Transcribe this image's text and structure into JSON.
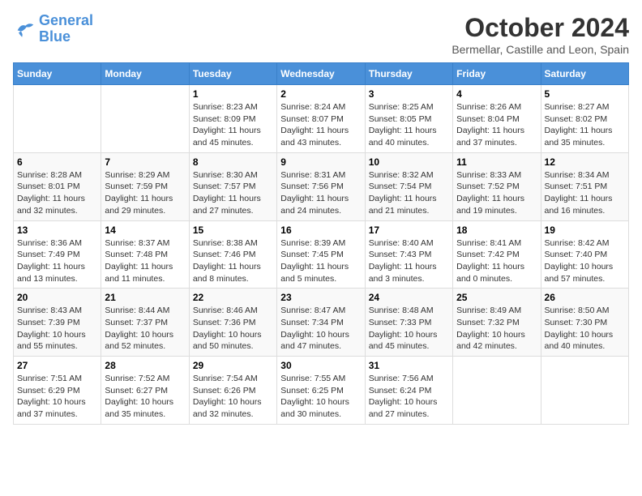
{
  "logo": {
    "text1": "General",
    "text2": "Blue"
  },
  "title": "October 2024",
  "location": "Bermellar, Castille and Leon, Spain",
  "days_header": [
    "Sunday",
    "Monday",
    "Tuesday",
    "Wednesday",
    "Thursday",
    "Friday",
    "Saturday"
  ],
  "weeks": [
    [
      {
        "day": "",
        "info": ""
      },
      {
        "day": "",
        "info": ""
      },
      {
        "day": "1",
        "info": "Sunrise: 8:23 AM\nSunset: 8:09 PM\nDaylight: 11 hours and 45 minutes."
      },
      {
        "day": "2",
        "info": "Sunrise: 8:24 AM\nSunset: 8:07 PM\nDaylight: 11 hours and 43 minutes."
      },
      {
        "day": "3",
        "info": "Sunrise: 8:25 AM\nSunset: 8:05 PM\nDaylight: 11 hours and 40 minutes."
      },
      {
        "day": "4",
        "info": "Sunrise: 8:26 AM\nSunset: 8:04 PM\nDaylight: 11 hours and 37 minutes."
      },
      {
        "day": "5",
        "info": "Sunrise: 8:27 AM\nSunset: 8:02 PM\nDaylight: 11 hours and 35 minutes."
      }
    ],
    [
      {
        "day": "6",
        "info": "Sunrise: 8:28 AM\nSunset: 8:01 PM\nDaylight: 11 hours and 32 minutes."
      },
      {
        "day": "7",
        "info": "Sunrise: 8:29 AM\nSunset: 7:59 PM\nDaylight: 11 hours and 29 minutes."
      },
      {
        "day": "8",
        "info": "Sunrise: 8:30 AM\nSunset: 7:57 PM\nDaylight: 11 hours and 27 minutes."
      },
      {
        "day": "9",
        "info": "Sunrise: 8:31 AM\nSunset: 7:56 PM\nDaylight: 11 hours and 24 minutes."
      },
      {
        "day": "10",
        "info": "Sunrise: 8:32 AM\nSunset: 7:54 PM\nDaylight: 11 hours and 21 minutes."
      },
      {
        "day": "11",
        "info": "Sunrise: 8:33 AM\nSunset: 7:52 PM\nDaylight: 11 hours and 19 minutes."
      },
      {
        "day": "12",
        "info": "Sunrise: 8:34 AM\nSunset: 7:51 PM\nDaylight: 11 hours and 16 minutes."
      }
    ],
    [
      {
        "day": "13",
        "info": "Sunrise: 8:36 AM\nSunset: 7:49 PM\nDaylight: 11 hours and 13 minutes."
      },
      {
        "day": "14",
        "info": "Sunrise: 8:37 AM\nSunset: 7:48 PM\nDaylight: 11 hours and 11 minutes."
      },
      {
        "day": "15",
        "info": "Sunrise: 8:38 AM\nSunset: 7:46 PM\nDaylight: 11 hours and 8 minutes."
      },
      {
        "day": "16",
        "info": "Sunrise: 8:39 AM\nSunset: 7:45 PM\nDaylight: 11 hours and 5 minutes."
      },
      {
        "day": "17",
        "info": "Sunrise: 8:40 AM\nSunset: 7:43 PM\nDaylight: 11 hours and 3 minutes."
      },
      {
        "day": "18",
        "info": "Sunrise: 8:41 AM\nSunset: 7:42 PM\nDaylight: 11 hours and 0 minutes."
      },
      {
        "day": "19",
        "info": "Sunrise: 8:42 AM\nSunset: 7:40 PM\nDaylight: 10 hours and 57 minutes."
      }
    ],
    [
      {
        "day": "20",
        "info": "Sunrise: 8:43 AM\nSunset: 7:39 PM\nDaylight: 10 hours and 55 minutes."
      },
      {
        "day": "21",
        "info": "Sunrise: 8:44 AM\nSunset: 7:37 PM\nDaylight: 10 hours and 52 minutes."
      },
      {
        "day": "22",
        "info": "Sunrise: 8:46 AM\nSunset: 7:36 PM\nDaylight: 10 hours and 50 minutes."
      },
      {
        "day": "23",
        "info": "Sunrise: 8:47 AM\nSunset: 7:34 PM\nDaylight: 10 hours and 47 minutes."
      },
      {
        "day": "24",
        "info": "Sunrise: 8:48 AM\nSunset: 7:33 PM\nDaylight: 10 hours and 45 minutes."
      },
      {
        "day": "25",
        "info": "Sunrise: 8:49 AM\nSunset: 7:32 PM\nDaylight: 10 hours and 42 minutes."
      },
      {
        "day": "26",
        "info": "Sunrise: 8:50 AM\nSunset: 7:30 PM\nDaylight: 10 hours and 40 minutes."
      }
    ],
    [
      {
        "day": "27",
        "info": "Sunrise: 7:51 AM\nSunset: 6:29 PM\nDaylight: 10 hours and 37 minutes."
      },
      {
        "day": "28",
        "info": "Sunrise: 7:52 AM\nSunset: 6:27 PM\nDaylight: 10 hours and 35 minutes."
      },
      {
        "day": "29",
        "info": "Sunrise: 7:54 AM\nSunset: 6:26 PM\nDaylight: 10 hours and 32 minutes."
      },
      {
        "day": "30",
        "info": "Sunrise: 7:55 AM\nSunset: 6:25 PM\nDaylight: 10 hours and 30 minutes."
      },
      {
        "day": "31",
        "info": "Sunrise: 7:56 AM\nSunset: 6:24 PM\nDaylight: 10 hours and 27 minutes."
      },
      {
        "day": "",
        "info": ""
      },
      {
        "day": "",
        "info": ""
      }
    ]
  ]
}
